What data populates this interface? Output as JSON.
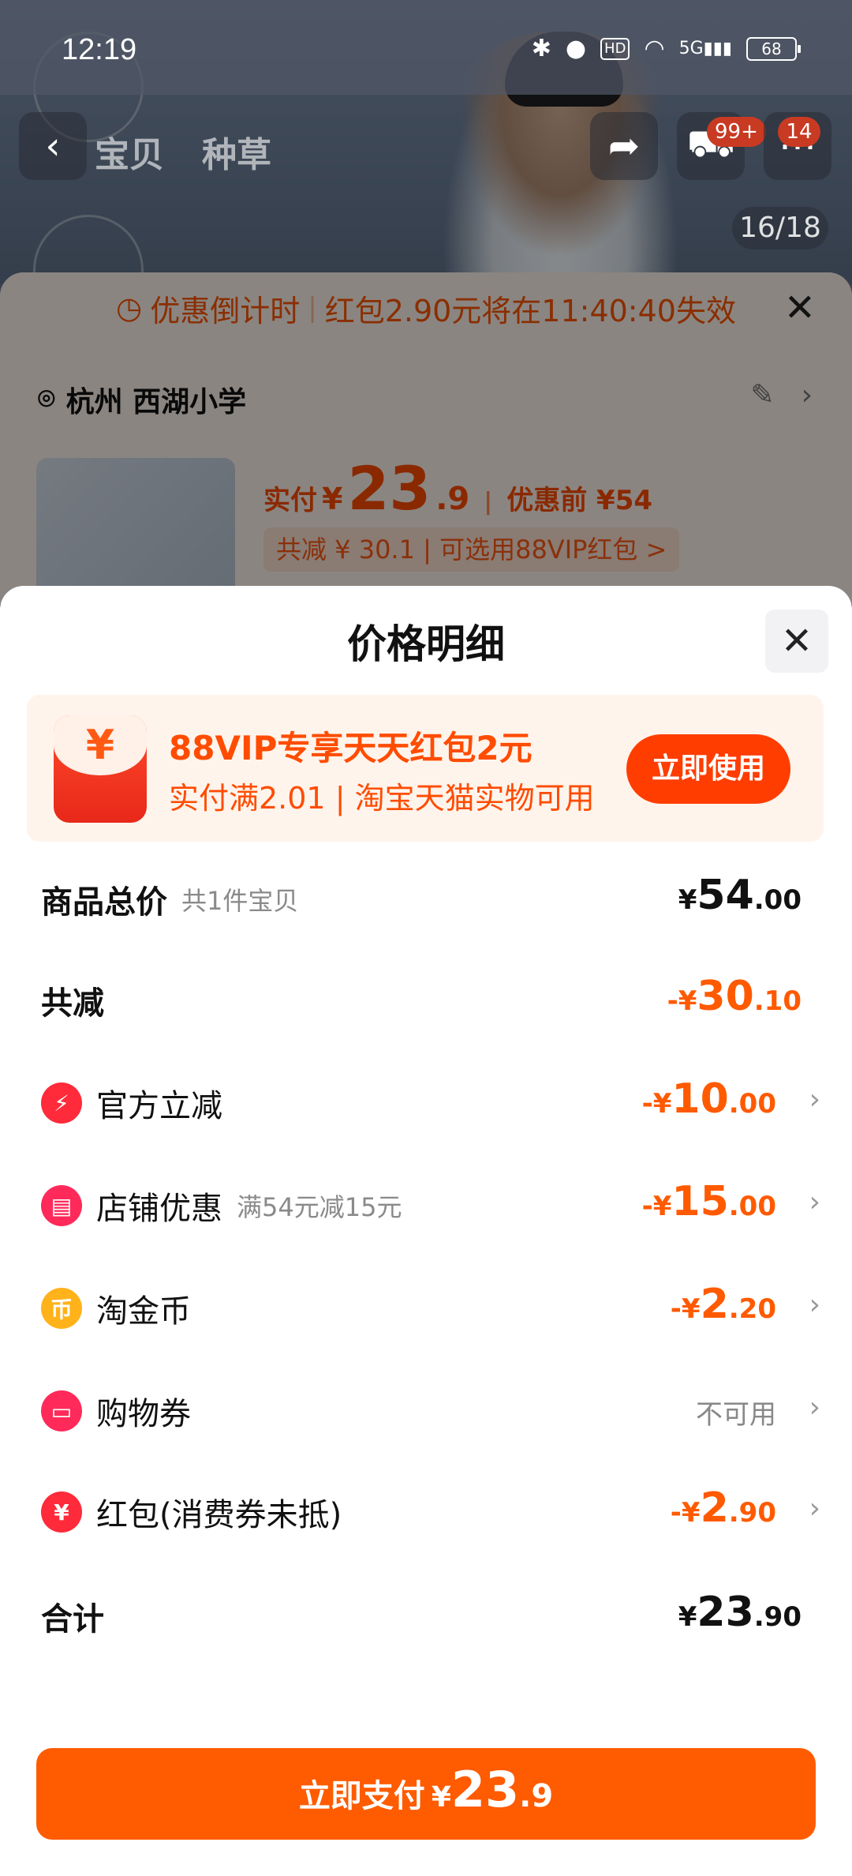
{
  "status_bar": {
    "time": "12:19",
    "hd": "HD",
    "network": "5G",
    "battery": "68"
  },
  "product_page": {
    "tabs": [
      "宝贝",
      "种草"
    ],
    "cart_badge": "99+",
    "message_badge": "14",
    "image_counter": "16/18"
  },
  "order_sheet": {
    "countdown_label": "优惠倒计时",
    "countdown_text": "红包2.90元将在11:40:40失效",
    "address": "杭州 西湖小学",
    "pay_label": "实付",
    "pay_yen": "¥",
    "pay_int": "23",
    "pay_dec": ".9",
    "before_label": "优惠前 ¥54",
    "saved_text": "共减 ¥ 30.1 | 可选用88VIP红包 >"
  },
  "price_detail": {
    "title": "价格明细",
    "promo": {
      "icon": "red-envelope-icon",
      "title": "88VIP专享天天红包2元",
      "subtitle": "实付满2.01 | 淘宝天猫实物可用",
      "button": "立即使用"
    },
    "rows": [
      {
        "label": "商品总价",
        "note": "共1件宝贝",
        "yen": "¥",
        "int": "54",
        "dec": ".00"
      },
      {
        "label": "共减",
        "yen": "-¥",
        "int": "30",
        "dec": ".10"
      },
      {
        "label": "官方立减",
        "icon": "lightning-icon",
        "yen": "-¥",
        "int": "10",
        "dec": ".00"
      },
      {
        "label": "店铺优惠",
        "note": "满54元减15元",
        "icon": "shop-icon",
        "yen": "-¥",
        "int": "15",
        "dec": ".00"
      },
      {
        "label": "淘金币",
        "icon": "coin-icon",
        "yen": "-¥",
        "int": "2",
        "dec": ".20"
      },
      {
        "label": "购物券",
        "icon": "ticket-icon",
        "value_text": "不可用"
      },
      {
        "label": "红包(消费券未抵)",
        "icon": "red-packet-icon",
        "yen": "-¥",
        "int": "2",
        "dec": ".90"
      },
      {
        "label": "合计",
        "yen": "¥",
        "int": "23",
        "dec": ".90"
      }
    ],
    "pay_button": {
      "label": "立即支付",
      "yen": "¥",
      "int": "23",
      "dec": ".9"
    }
  },
  "colors": {
    "accent": "#ff5a00",
    "button": "#ff5b00",
    "promo_bg": "#fff4ec"
  }
}
